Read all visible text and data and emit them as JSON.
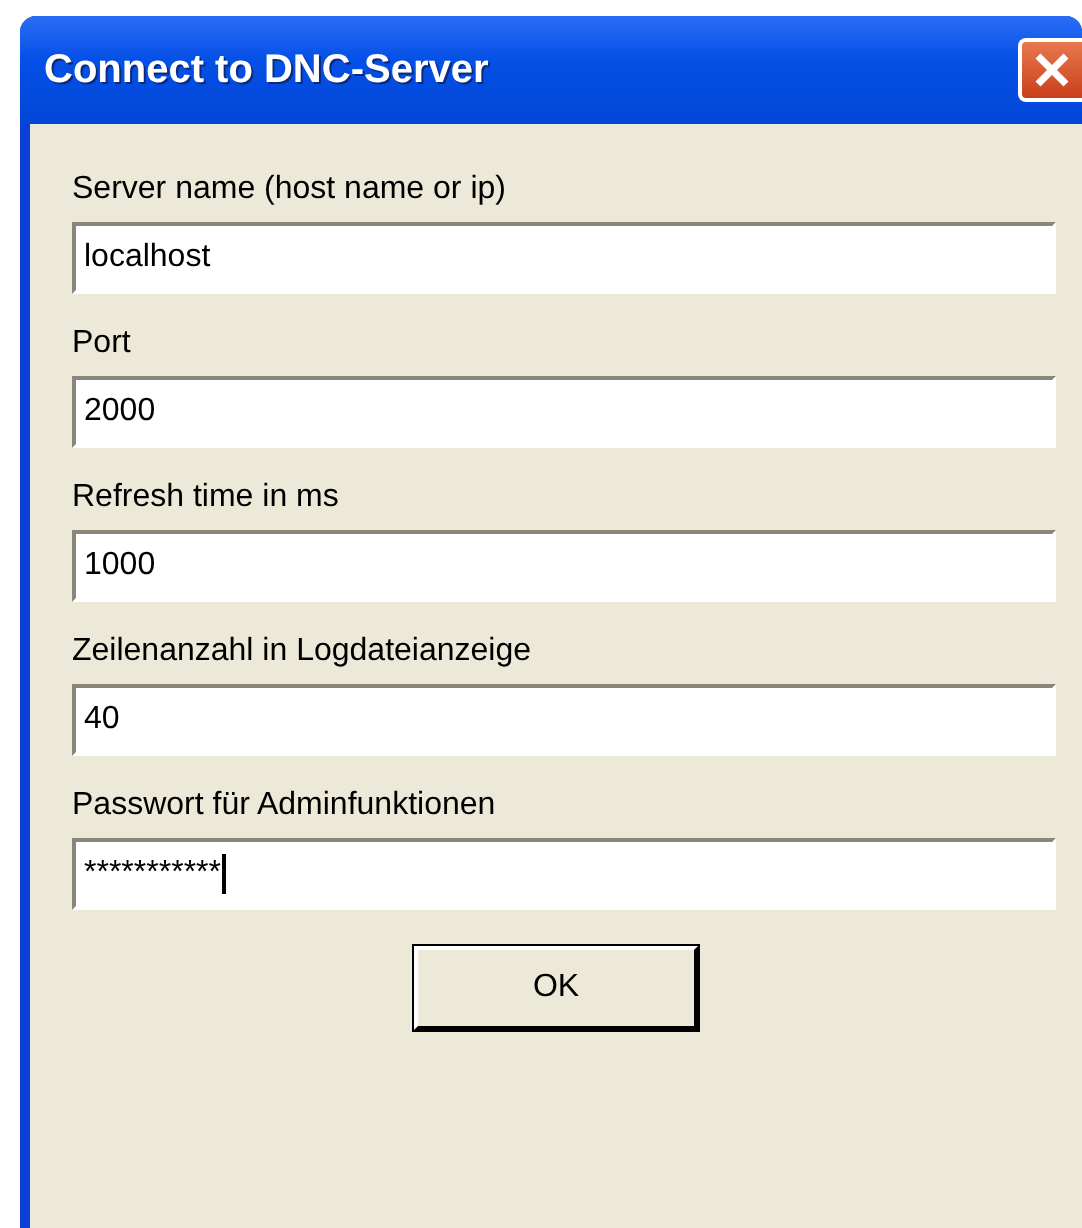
{
  "window": {
    "title": "Connect to DNC-Server"
  },
  "fields": [
    {
      "label": "Server name (host name or ip)",
      "value": "localhost",
      "focused": false
    },
    {
      "label": "Port",
      "value": "2000",
      "focused": false
    },
    {
      "label": "Refresh time in ms",
      "value": "1000",
      "focused": false
    },
    {
      "label": "Zeilenanzahl in Logdateianzeige",
      "value": "40",
      "focused": false
    },
    {
      "label": "Passwort für Adminfunktionen",
      "value": "***********",
      "focused": true
    }
  ],
  "buttons": [
    "OK"
  ]
}
